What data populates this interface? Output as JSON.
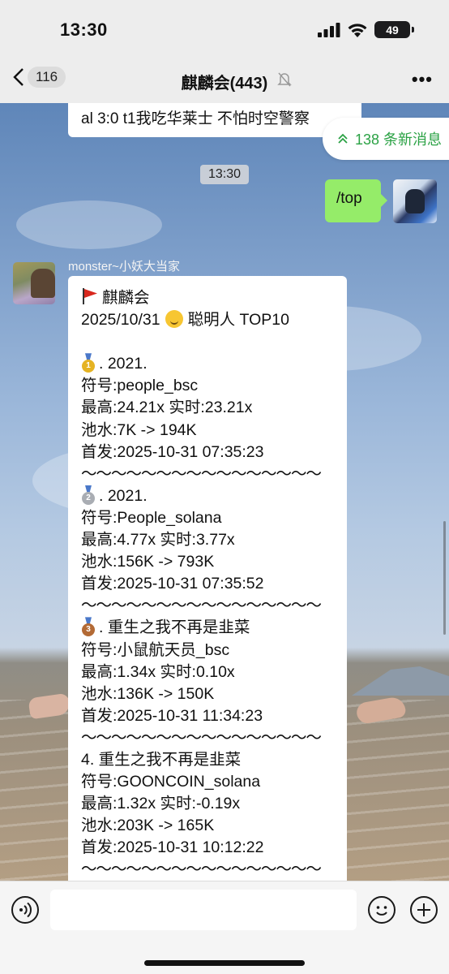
{
  "status_bar": {
    "time": "13:30",
    "battery": "49"
  },
  "nav": {
    "back_count": "116",
    "title": "麒麟会(443)"
  },
  "chat": {
    "previous_message": "al 3:0 t1我吃华莱士 不怕时空警察",
    "new_messages_label": "138 条新消息",
    "timestamp": "13:30",
    "my_message": "/top",
    "sender_name": "monster~小妖大当家",
    "main_message": {
      "header": "麒麟会",
      "date": "2025/10/31",
      "top_label": "聪明人 TOP10",
      "items": [
        {
          "medal": "gold",
          "rank": "1",
          "title": ". 2021.",
          "symbol": "符号:people_bsc",
          "stats": "最高:24.21x 实时:23.21x",
          "pool": "池水:7K -> 194K",
          "launch": "首发:2025-10-31 07:35:23"
        },
        {
          "medal": "silver",
          "rank": "2",
          "title": ". 2021.",
          "symbol": "符号:People_solana",
          "stats": "最高:4.77x 实时:3.77x",
          "pool": "池水:156K -> 793K",
          "launch": "首发:2025-10-31 07:35:52"
        },
        {
          "medal": "bronze",
          "rank": "3",
          "title": ". 重生之我不再是韭菜",
          "symbol": "符号:小鼠航天员_bsc",
          "stats": "最高:1.34x 实时:0.10x",
          "pool": "池水:136K -> 150K",
          "launch": "首发:2025-10-31 11:34:23"
        },
        {
          "medal": "",
          "rank": "",
          "title": "4. 重生之我不再是韭菜",
          "symbol": "符号:GOONCOIN_solana",
          "stats": "最高:1.32x 实时:-0.19x",
          "pool": "池水:203K -> 165K",
          "launch": "首发:2025-10-31 10:12:22"
        }
      ],
      "separator": "～～～～～～～～～～～～～～～～"
    }
  }
}
